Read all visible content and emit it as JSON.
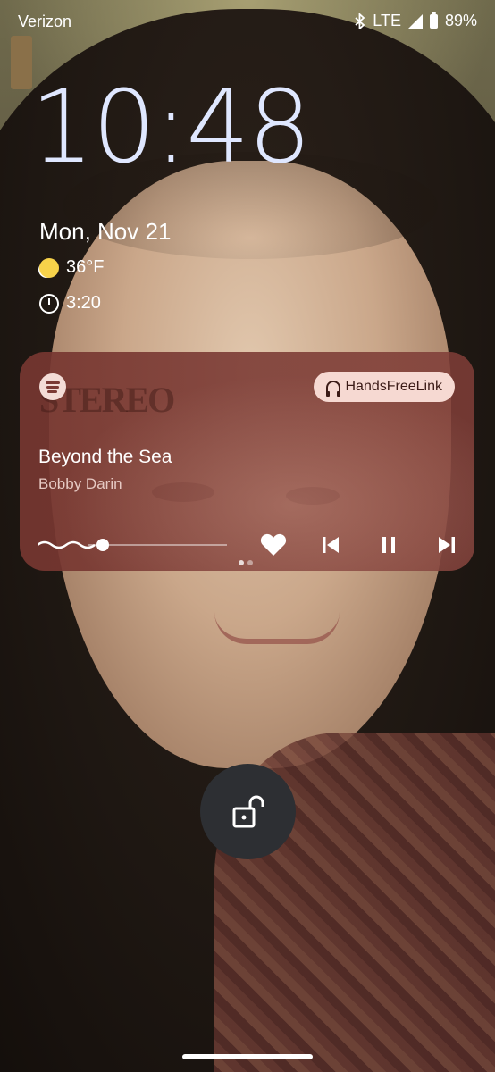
{
  "status_bar": {
    "carrier": "Verizon",
    "network": "LTE",
    "battery": "89%",
    "icons": [
      "bluetooth-icon",
      "signal-icon",
      "battery-icon"
    ]
  },
  "lockscreen": {
    "time": "10:48",
    "date": "Mon, Nov 21",
    "weather": {
      "icon": "sunny-icon",
      "temperature": "36°F"
    },
    "alarm": {
      "icon": "alarm-icon",
      "time": "3:20"
    }
  },
  "media_player": {
    "app_icon": "spotify-icon",
    "album_art_text": "STEREO",
    "output_device": "HandsFreeLink",
    "output_icon": "headphones-icon",
    "title": "Beyond the Sea",
    "artist": "Bobby Darin",
    "progress": 0.1,
    "controls": [
      "like-icon",
      "skip-previous-icon",
      "pause-icon",
      "skip-next-icon"
    ],
    "page_indicator": {
      "count": 2,
      "active": 0
    },
    "accent_color": "#7b3a34"
  },
  "unlock": {
    "icon": "unlock-icon"
  }
}
